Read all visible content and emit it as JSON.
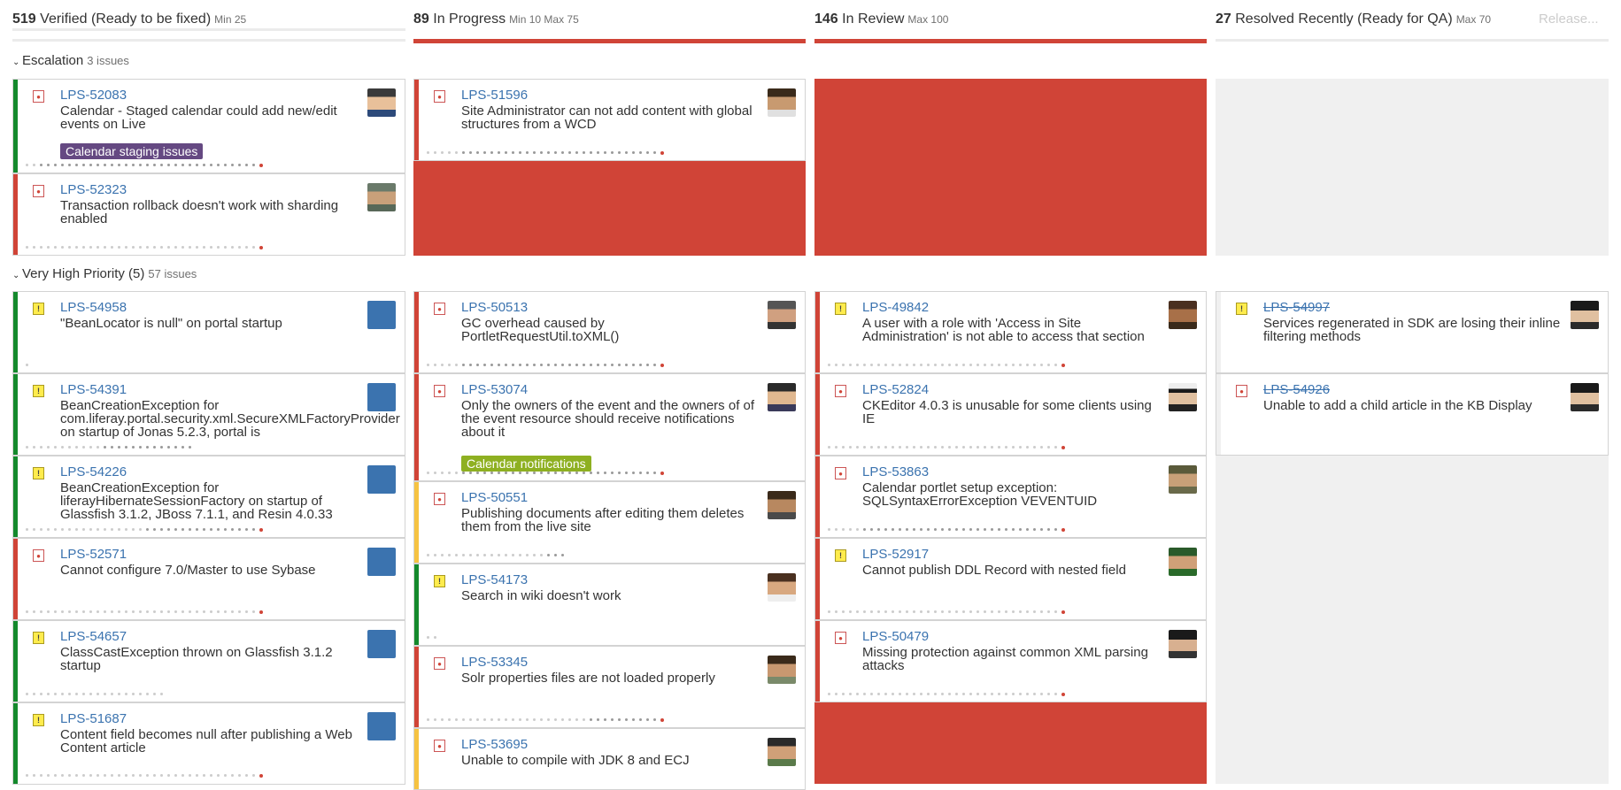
{
  "colors": {
    "alert_red": "#d04437",
    "link_blue": "#3b73af",
    "priority_green": "#14892c",
    "priority_red": "#d04437",
    "priority_yellow": "#f6c342"
  },
  "columns": [
    {
      "count": "519",
      "title": "Verified (Ready to be fixed)",
      "limit": "Min 25"
    },
    {
      "count": "89",
      "title": "In Progress",
      "limit": "Min 10  Max 75"
    },
    {
      "count": "146",
      "title": "In Review",
      "limit": "Max 100"
    },
    {
      "count": "27",
      "title": "Resolved Recently (Ready for QA)",
      "limit": "Max 70"
    }
  ],
  "release_button": "Release...",
  "swimlanes": [
    {
      "name": "Escalation",
      "issues": "3 issues"
    },
    {
      "name": "Very High Priority (5)",
      "issues": "57 issues"
    }
  ],
  "cards": {
    "c1": {
      "key": "LPS-52083",
      "summary": "Calendar - Staged calendar could add new/edit events on Live",
      "label": "Calendar staging issues"
    },
    "c2": {
      "key": "LPS-52323",
      "summary": "Transaction rollback doesn't work with sharding enabled"
    },
    "c3": {
      "key": "LPS-51596",
      "summary": "Site Administrator can not add content with global structures from a WCD"
    },
    "c4": {
      "key": "LPS-54958",
      "summary": "\"BeanLocator is null\" on portal startup"
    },
    "c5": {
      "key": "LPS-54391",
      "summary": "BeanCreationException for com.liferay.portal.security.xml.SecureXMLFactoryProvider on startup of Jonas 5.2.3, portal is"
    },
    "c6": {
      "key": "LPS-54226",
      "summary": "BeanCreationException for liferayHibernateSessionFactory on startup of Glassfish 3.1.2, JBoss 7.1.1, and Resin 4.0.33"
    },
    "c7": {
      "key": "LPS-52571",
      "summary": "Cannot configure 7.0/Master to use Sybase"
    },
    "c8": {
      "key": "LPS-54657",
      "summary": "ClassCastException thrown on Glassfish 3.1.2 startup"
    },
    "c9": {
      "key": "LPS-51687",
      "summary": "Content field becomes null after publishing a Web Content article"
    },
    "c10": {
      "key": "LPS-50513",
      "summary": "GC overhead caused by PortletRequestUtil.toXML()"
    },
    "c11": {
      "key": "LPS-53074",
      "summary": "Only the owners of the event and the owners of of the event resource should receive notifications about it",
      "label": "Calendar notifications"
    },
    "c12": {
      "key": "LPS-50551",
      "summary": "Publishing documents after editing them deletes them from the live site"
    },
    "c13": {
      "key": "LPS-54173",
      "summary": "Search in wiki doesn't work"
    },
    "c14": {
      "key": "LPS-53345",
      "summary": "Solr properties files are not loaded properly"
    },
    "c15": {
      "key": "LPS-53695",
      "summary": "Unable to compile with JDK 8 and ECJ"
    },
    "c16": {
      "key": "LPS-49842",
      "summary": "A user with a role with 'Access in Site Administration' is not able to access that section"
    },
    "c17": {
      "key": "LPS-52824",
      "summary": "CKEditor 4.0.3 is unusable for some clients using IE"
    },
    "c18": {
      "key": "LPS-53863",
      "summary": "Calendar portlet setup exception: SQLSyntaxErrorException VEVENTUID"
    },
    "c19": {
      "key": "LPS-52917",
      "summary": "Cannot publish DDL Record with nested field"
    },
    "c20": {
      "key": "LPS-50479",
      "summary": "Missing protection against common XML parsing attacks"
    },
    "c21": {
      "key": "LPS-54997",
      "summary": "Services regenerated in SDK are losing their inline filtering methods"
    },
    "c22": {
      "key": "LPS-54926",
      "summary": "Unable to add a child article in the KB Display"
    }
  }
}
